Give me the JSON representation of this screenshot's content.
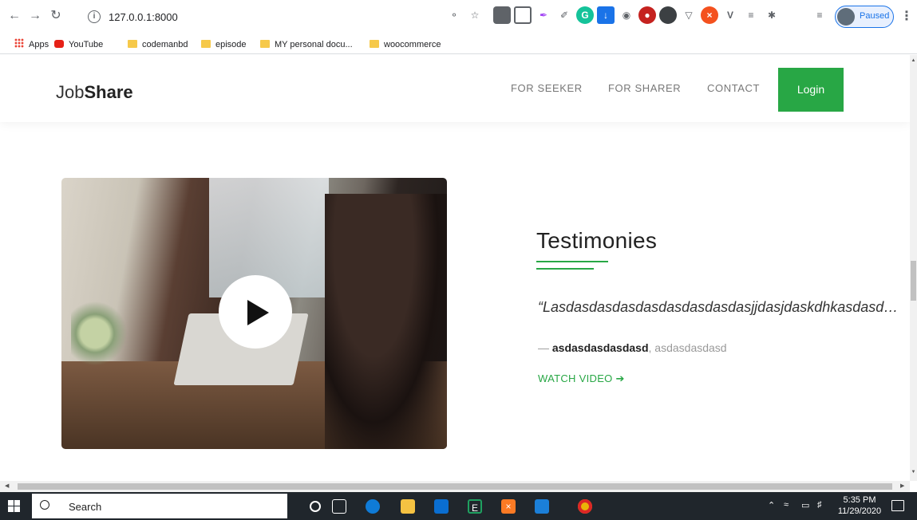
{
  "browser": {
    "url": "127.0.0.1:8000",
    "profile_status": "Paused",
    "bookmarks": [
      {
        "label": "Apps",
        "icon": "apps-grid-icon"
      },
      {
        "label": "YouTube",
        "icon": "youtube-icon"
      },
      {
        "label": "codemanbd",
        "icon": "folder-icon"
      },
      {
        "label": "episode",
        "icon": "folder-icon"
      },
      {
        "label": "MY personal docu...",
        "icon": "folder-icon"
      },
      {
        "label": "woocommerce",
        "icon": "folder-icon"
      }
    ]
  },
  "site": {
    "logo_light": "Job",
    "logo_bold": "Share",
    "nav": [
      "FOR SEEKER",
      "FOR SHARER",
      "CONTACT"
    ],
    "login": "Login"
  },
  "testimonial": {
    "title": "Testimonies",
    "quote": "“Lasdasdasdasdasdasdasdasdasjjdasjdaskdhkasdasd…",
    "dash": "—",
    "author": "asdasdasdasdasd",
    "separator": ",",
    "role": "asdasdasdasd",
    "watch_label": "WATCH VIDEO",
    "watch_arrow": "➔"
  },
  "taskbar": {
    "search_label": "Search",
    "time": "5:35 PM",
    "date": "11/29/2020"
  },
  "colors": {
    "accent": "#28a745",
    "taskbar": "#20262c"
  }
}
